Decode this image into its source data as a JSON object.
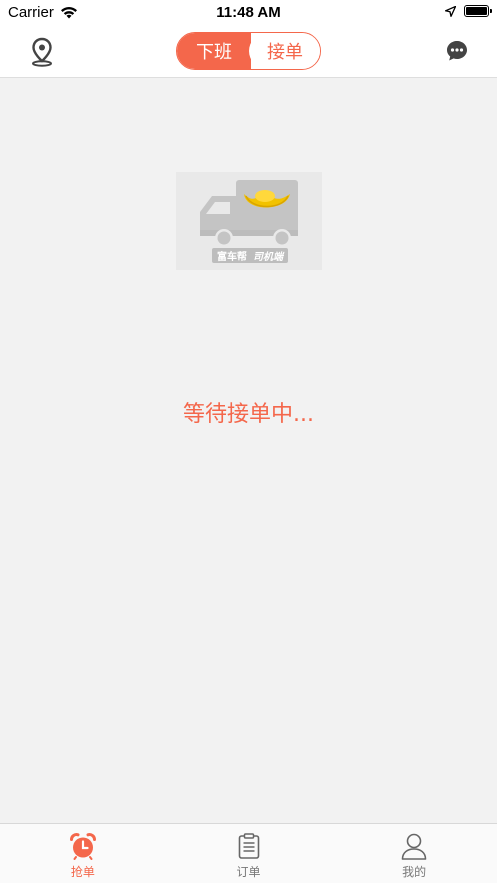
{
  "status_bar": {
    "carrier": "Carrier",
    "time": "11:48 AM"
  },
  "nav": {
    "toggle_off_label": "下班",
    "toggle_on_label": "接单"
  },
  "logo": {
    "brand_left": "富车帮",
    "brand_right": "司机端"
  },
  "main": {
    "waiting_text": "等待接单中..."
  },
  "tabs": [
    {
      "label": "抢单",
      "icon": "alarm-clock-icon",
      "active": true
    },
    {
      "label": "订单",
      "icon": "clipboard-icon",
      "active": false
    },
    {
      "label": "我的",
      "icon": "user-icon",
      "active": false
    }
  ],
  "colors": {
    "accent": "#f4674b",
    "background": "#f2f2f2"
  }
}
